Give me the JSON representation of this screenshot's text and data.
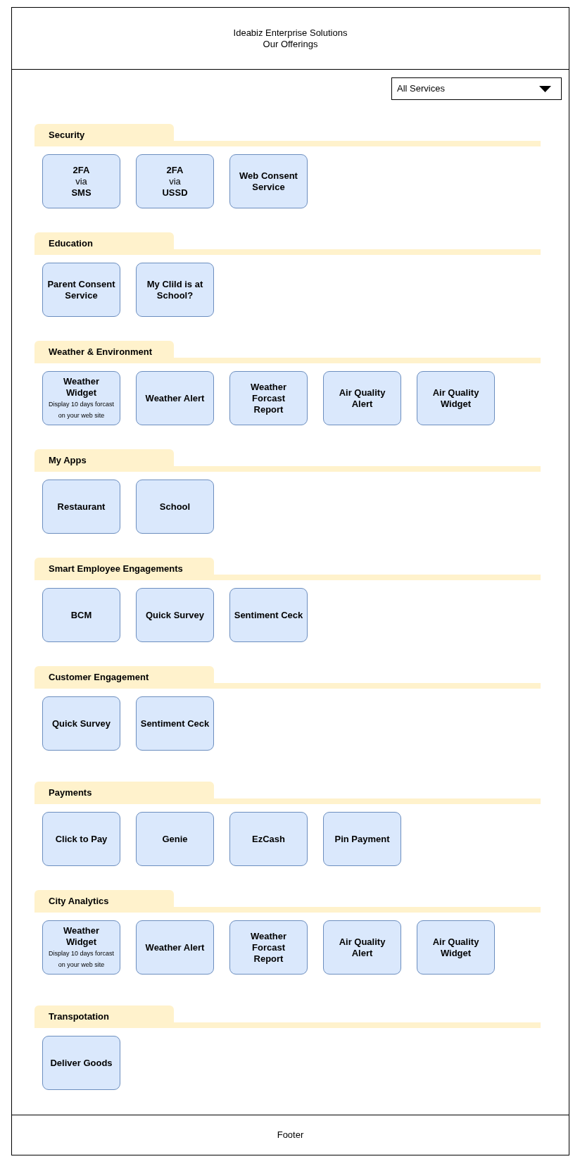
{
  "header": {
    "title": "Ideabiz Enterprise Solutions",
    "subtitle": "Our Offerings"
  },
  "filter": {
    "value": "All Services"
  },
  "sections": [
    {
      "title": "Security",
      "cards": [
        {
          "kind": "rich",
          "label": "**2FA**\nvia\n**SMS**"
        },
        {
          "kind": "rich",
          "label": "**2FA**\nvia\n**USSD**"
        },
        {
          "kind": "title",
          "label": "Web Consent\nService"
        }
      ]
    },
    {
      "title": "Education",
      "cards": [
        {
          "kind": "title",
          "label": "Parent Consent\nService"
        },
        {
          "kind": "title",
          "label": "My Clild is at\nSchool?"
        }
      ]
    },
    {
      "title": "Weather & Environment",
      "cards": [
        {
          "kind": "title",
          "label": "Weather\nWidget",
          "note": "Display 10 days forcast\non your web site"
        },
        {
          "kind": "title",
          "label": "Weather Alert"
        },
        {
          "kind": "title",
          "label": "Weather\nForcast\nReport"
        },
        {
          "kind": "title",
          "label": "Air Quality\nAlert"
        },
        {
          "kind": "title",
          "label": "Air Quality\nWidget"
        }
      ]
    },
    {
      "title": "My Apps",
      "cards": [
        {
          "kind": "title",
          "label": "Restaurant"
        },
        {
          "kind": "title",
          "label": "School"
        }
      ]
    },
    {
      "title": "Smart Employee Engagements",
      "cards": [
        {
          "kind": "title",
          "label": "BCM"
        },
        {
          "kind": "title",
          "label": "Quick Survey"
        },
        {
          "kind": "title",
          "label": "Sentiment Ceck"
        }
      ]
    },
    {
      "title": "Customer Engagement",
      "cards": [
        {
          "kind": "title",
          "label": "Quick Survey"
        },
        {
          "kind": "title",
          "label": "Sentiment Ceck"
        }
      ]
    },
    {
      "title": "Payments",
      "cards": [
        {
          "kind": "title",
          "label": "Click to Pay"
        },
        {
          "kind": "title",
          "label": "Genie"
        },
        {
          "kind": "title",
          "label": "EzCash"
        },
        {
          "kind": "title",
          "label": "Pin Payment"
        }
      ]
    },
    {
      "title": "City Analytics",
      "cards": [
        {
          "kind": "title",
          "label": "Weather\nWidget",
          "note": "Display 10 days forcast\non your web site"
        },
        {
          "kind": "title",
          "label": "Weather Alert"
        },
        {
          "kind": "title",
          "label": "Weather\nForcast\nReport"
        },
        {
          "kind": "title",
          "label": "Air Quality\nAlert"
        },
        {
          "kind": "title",
          "label": "Air Quality\nWidget"
        }
      ]
    },
    {
      "title": "Transpotation",
      "cards": [
        {
          "kind": "title",
          "label": "Deliver Goods"
        }
      ]
    }
  ],
  "footer": {
    "text": "Footer"
  }
}
